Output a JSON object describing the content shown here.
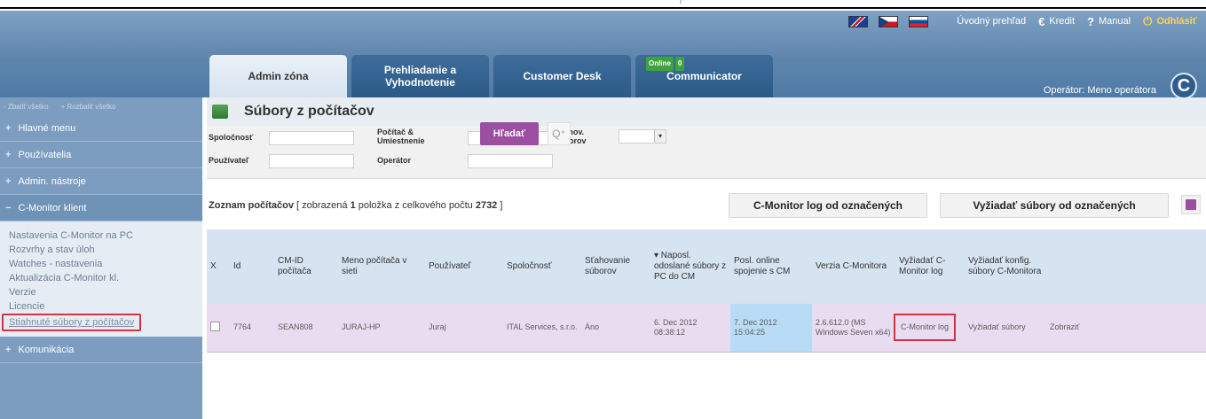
{
  "caption": "/",
  "topbar": {
    "flags": [
      "uk-flag-icon",
      "cz-flag-icon",
      "sk-flag-icon"
    ],
    "overview": "Úvodný prehľad",
    "credit_symbol": "€",
    "credit": "Kredit",
    "manual_symbol": "?",
    "manual": "Manual",
    "logout_symbol": "⏻",
    "logout": "Odhlásiť"
  },
  "tabs": [
    {
      "label": "Admin zóna"
    },
    {
      "label": "Prehliadanie a Vyhodnotenie"
    },
    {
      "label": "Customer Desk"
    },
    {
      "label": "Communicator",
      "badge_online": "Online",
      "badge_count": "0"
    }
  ],
  "operator": "Operátor: Meno operátora",
  "logo_letter": "C",
  "sidebar": {
    "collapse_all": "- Zbaliť všetko",
    "expand_all": "+ Rozbaliť všetko",
    "sections": [
      {
        "label": "Hlavné menu"
      },
      {
        "label": "Používatelia"
      },
      {
        "label": "Admin. nástroje"
      },
      {
        "label": "C-Monitor klient"
      }
    ],
    "sub_items": [
      "Nastavenia C-Monitor na PC",
      "Rozvrhy a stav úloh",
      "Watches - nastavenia",
      "Aktualizácia C-Monitor kl.",
      "Verzie",
      "Licencie"
    ],
    "highlighted_item": "Stiahnuté súbory z počítačov",
    "bottom_section": "Komunikácia"
  },
  "page": {
    "title": "Súbory z počítačov"
  },
  "filters": {
    "company": "Spoločnosť",
    "user": "Používateľ",
    "computer": "Počítač & Umiestnenie",
    "operator": "Operátor",
    "download": "Sťahov. súborov",
    "search": "Hľadať",
    "clear_symbol": "Q⁺"
  },
  "list": {
    "prefix": "Zoznam počítačov",
    "shown_pre": " [ zobrazená ",
    "shown_count": "1",
    "shown_mid": " položka z celkového počtu ",
    "total": "2732",
    "shown_post": " ]",
    "btn_log": "C-Monitor log od označených",
    "btn_files": "Vyžiadať súbory od označených"
  },
  "table": {
    "headers": {
      "x": "X",
      "id": "Id",
      "cmid": "CM-ID počítača",
      "name": "Meno počítača v sieti",
      "user": "Používateľ",
      "company": "Spoločnosť",
      "downloading": "Sťahovanie súborov",
      "last_sent": "▾ Naposl. odoslané súbory z PC do CM",
      "last_online": "Posl. online spojenie s CM",
      "version": "Verzia C-Monitora",
      "req_log": "Vyžiadať C-Monitor log",
      "req_conf": "Vyžiadať konfig. súbory C-Monitora"
    },
    "rows": [
      {
        "id": "7764",
        "cmid": "SEAN808",
        "name": "JURAJ-HP",
        "user": "Juraj",
        "company": "ITAL Services, s.r.o.",
        "downloading": "Áno",
        "last_sent": "6. Dec 2012 08:38:12",
        "last_online": "7. Dec 2012 15:04:25",
        "version": "2.6.612.0 (MS Windows Seven x64)",
        "log": "C-Monitor log",
        "request": "Vyžiadať súbory",
        "show": "Zobraziť"
      }
    ]
  },
  "colors": {
    "header": "#5f85ad",
    "sidebar": "#7c9dc0",
    "accent_button": "#9c4ea1",
    "row_bg": "#eadcf0",
    "highlight_cell": "#b9dcf6",
    "callout": "#d0343f"
  }
}
